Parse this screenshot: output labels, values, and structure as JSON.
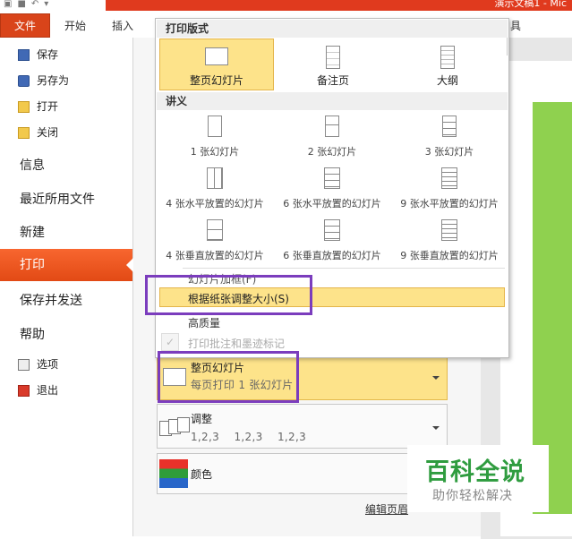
{
  "window": {
    "title": "演示文稿1 - Mic"
  },
  "ribbon": {
    "tabs": [
      "文件",
      "开始",
      "插入"
    ],
    "partial_tab": "具"
  },
  "backstage": {
    "small_items": [
      {
        "label": "保存",
        "icon": "save-icon"
      },
      {
        "label": "另存为",
        "icon": "save-as-icon"
      },
      {
        "label": "打开",
        "icon": "open-folder-icon"
      },
      {
        "label": "关闭",
        "icon": "close-folder-icon"
      }
    ],
    "big_items": [
      "信息",
      "最近所用文件",
      "新建"
    ],
    "active": "打印",
    "big_items2": [
      "保存并发送",
      "帮助"
    ],
    "bottom_items": [
      {
        "label": "选项",
        "icon": "options-icon"
      },
      {
        "label": "退出",
        "icon": "exit-icon"
      }
    ]
  },
  "settings": {
    "layout_option": {
      "title": "整页幻灯片",
      "sub": "每页打印 1 张幻灯片"
    },
    "collate_option": {
      "title": "调整",
      "sub": "1,2,3    1,2,3    1,2,3"
    },
    "color_option": {
      "title": "颜色"
    },
    "footer_link": "编辑页眉"
  },
  "dropdown": {
    "section1": "打印版式",
    "layouts": [
      "整页幻灯片",
      "备注页",
      "大纲"
    ],
    "section2": "讲义",
    "handouts_row1": [
      "1 张幻灯片",
      "2 张幻灯片",
      "3 张幻灯片"
    ],
    "handouts_row2": [
      "4 张水平放置的幻灯片",
      "6 张水平放置的幻灯片",
      "9 张水平放置的幻灯片"
    ],
    "handouts_row3": [
      "4 张垂直放置的幻灯片",
      "6 张垂直放置的幻灯片",
      "9 张垂直放置的幻灯片"
    ],
    "menu_items": [
      "幻灯片加框(F)",
      "根据纸张调整大小(S)",
      "高质量",
      "打印批注和墨迹标记"
    ]
  },
  "watermark": {
    "line1": "百科全说",
    "line2": "助你轻松解决"
  },
  "colors": {
    "accent": "#e24a15",
    "highlight": "#fde38a",
    "callout": "#7b3dbd",
    "slide_green": "#8fd14f"
  }
}
